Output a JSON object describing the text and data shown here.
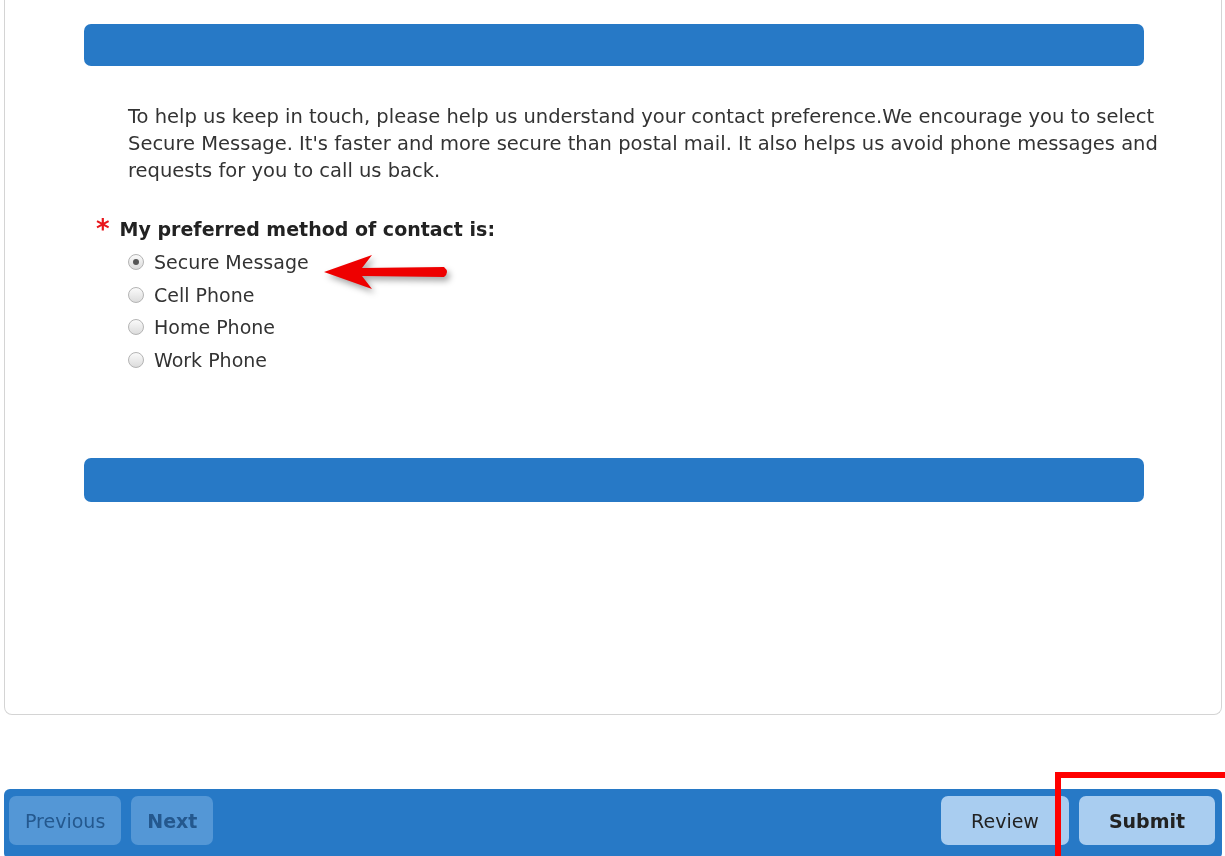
{
  "intro": "To help us keep in touch, please help us understand your contact preference.We encourage you to select Secure Message. It's faster and more secure than postal mail. It also helps us avoid phone messages and requests for you to call us back.",
  "question": {
    "required_mark": "*",
    "label": "My preferred method of contact is:",
    "options": [
      {
        "label": "Secure Message",
        "selected": true
      },
      {
        "label": "Cell Phone",
        "selected": false
      },
      {
        "label": "Home Phone",
        "selected": false
      },
      {
        "label": "Work Phone",
        "selected": false
      }
    ]
  },
  "footer": {
    "left_buttons": [
      {
        "label": "Previous",
        "disabled": true,
        "bold": false
      },
      {
        "label": "Next",
        "disabled": true,
        "bold": true
      }
    ],
    "right_buttons": [
      {
        "label": "Review",
        "disabled": false,
        "bold": false
      },
      {
        "label": "Submit",
        "disabled": false,
        "bold": true
      }
    ]
  },
  "annotations": {
    "arrow": true,
    "frame": true
  }
}
